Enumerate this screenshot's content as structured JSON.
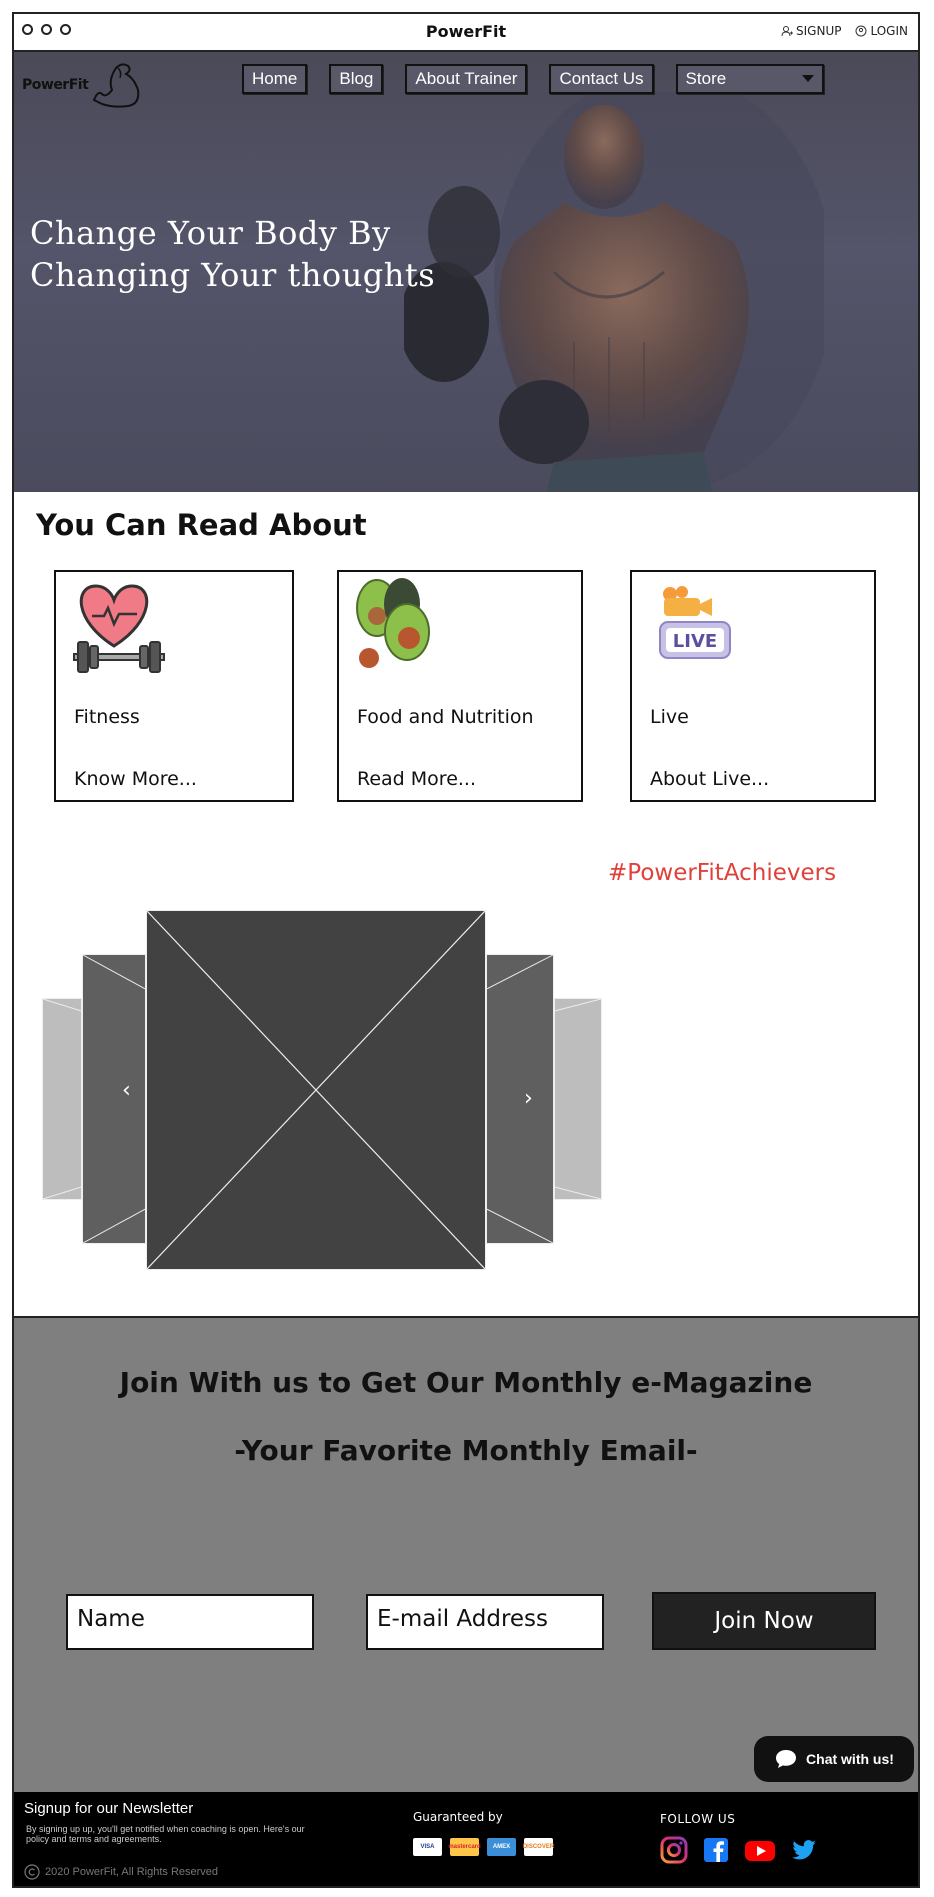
{
  "window": {
    "title": "PowerFit",
    "signup_label": "SIGNUP",
    "login_label": "LOGIN"
  },
  "logo": {
    "text": "PowerFit"
  },
  "nav": {
    "home": "Home",
    "blog": "Blog",
    "about": "About Trainer",
    "contact": "Contact Us",
    "store": "Store"
  },
  "hero": {
    "headline_line1": "Change Your Body By",
    "headline_line2": "Changing Your thoughts"
  },
  "read_section": {
    "title": "You Can Read About",
    "cards": [
      {
        "title": "Fitness",
        "link": "Know More...",
        "icon": "heart-dumbbell-icon"
      },
      {
        "title": "Food and Nutrition",
        "link": "Read More...",
        "icon": "avocado-icon"
      },
      {
        "title": "Live",
        "link": "About Live...",
        "icon": "live-camera-icon"
      }
    ]
  },
  "hashtag": "#PowerFitAchievers",
  "carousel": {
    "prev_label": "‹",
    "next_label": "›"
  },
  "newsletter_band": {
    "heading": "Join With us to Get Our Monthly e-Magazine",
    "subheading": "-Your Favorite Monthly Email-",
    "name_placeholder": "Name",
    "email_placeholder": "E-mail Address",
    "join_label": "Join Now"
  },
  "chat": {
    "label": "Chat with us!"
  },
  "footer": {
    "newsletter_title": "Signup for our Newsletter",
    "newsletter_text": "By signing up up, you'll get notified when coaching is open. Here's our policy and terms and agreements.",
    "copyright": "2020 PowerFit, All Rights Reserved",
    "guaranteed": "Guaranteed by",
    "payment": [
      "VISA",
      "mastercard",
      "AMEX",
      "DISCOVER"
    ],
    "follow": "FOLLOW US",
    "social": [
      "instagram-icon",
      "facebook-icon",
      "youtube-icon",
      "twitter-icon"
    ]
  },
  "colors": {
    "hero_bg": "#4f4f63",
    "hashtag": "#e0413a",
    "band_bg": "#7f7f7f",
    "footer_bg": "#000000"
  }
}
